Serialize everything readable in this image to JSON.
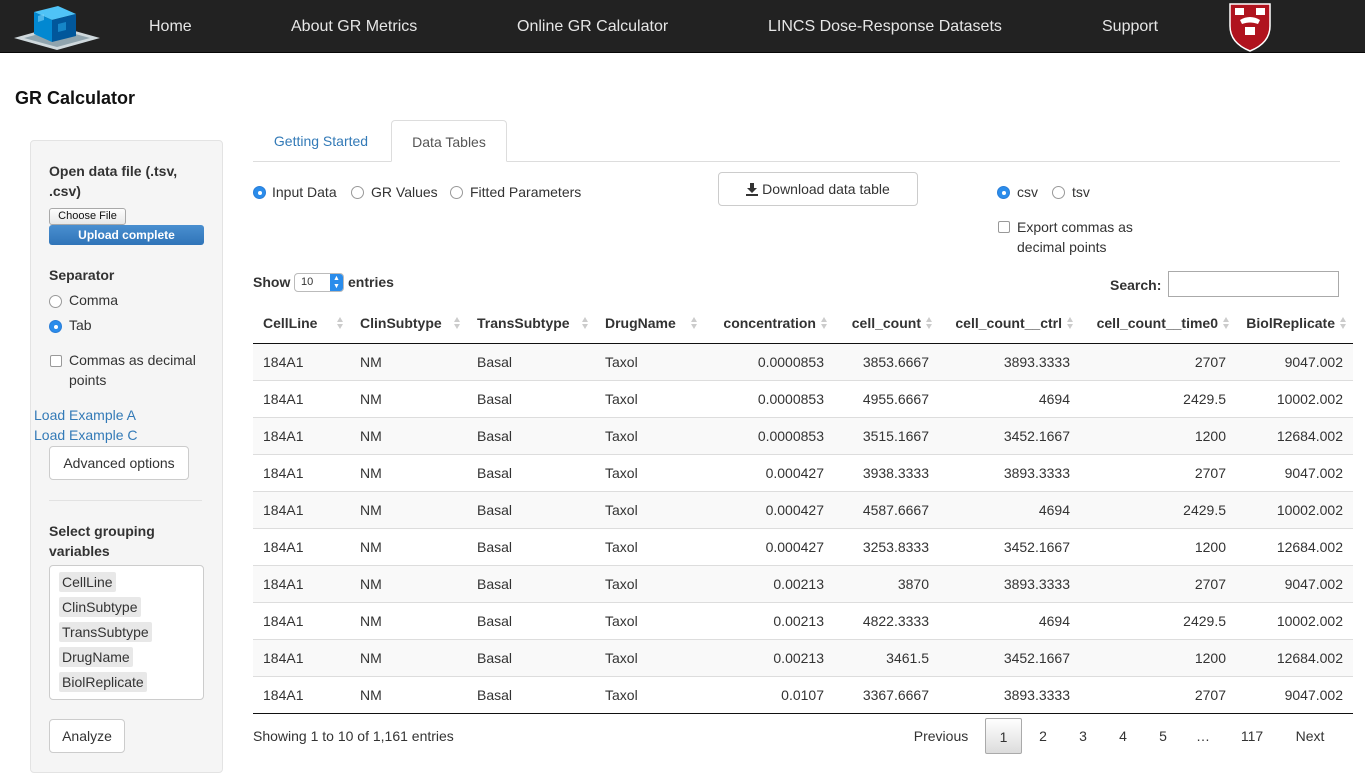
{
  "navbar": {
    "items": [
      "Home",
      "About GR Metrics",
      "Online GR Calculator",
      "LINCS Dose-Response Datasets",
      "Support"
    ]
  },
  "page_title": "GR Calculator",
  "sidebar": {
    "open_file_label": "Open data file (.tsv, .csv)",
    "choose_file": "Choose File",
    "upload_status": "Upload complete",
    "upload_progress": 1.0,
    "separator_label": "Separator",
    "separator_options": [
      "Comma",
      "Tab"
    ],
    "separator_selected": "Tab",
    "commas_decimal": "Commas as decimal points",
    "commas_decimal_checked": false,
    "load_example_a": "Load Example A",
    "load_example_c": "Load Example C",
    "advanced_options": "Advanced options",
    "grouping_label": "Select grouping variables",
    "grouping_variables": [
      "CellLine",
      "ClinSubtype",
      "TransSubtype",
      "DrugName",
      "BiolReplicate"
    ],
    "analyze": "Analyze"
  },
  "tabs": {
    "items": [
      "Getting Started",
      "Data Tables"
    ],
    "active": "Data Tables"
  },
  "data_view": {
    "options": [
      "Input Data",
      "GR Values",
      "Fitted Parameters"
    ],
    "selected": "Input Data",
    "download_label": "Download data table",
    "format_options": [
      "csv",
      "tsv"
    ],
    "format_selected": "csv",
    "export_commas": "Export commas as decimal points",
    "export_commas_checked": false
  },
  "table": {
    "show": "Show",
    "entries": "entries",
    "page_length": "10",
    "search_label": "Search:",
    "search_value": "",
    "columns": [
      "CellLine",
      "ClinSubtype",
      "TransSubtype",
      "DrugName",
      "concentration",
      "cell_count",
      "cell_count__ctrl",
      "cell_count__time0",
      "BiolReplicate"
    ],
    "rows": [
      [
        "184A1",
        "NM",
        "Basal",
        "Taxol",
        "0.0000853",
        "3853.6667",
        "3893.3333",
        "2707",
        "9047.002"
      ],
      [
        "184A1",
        "NM",
        "Basal",
        "Taxol",
        "0.0000853",
        "4955.6667",
        "4694",
        "2429.5",
        "10002.002"
      ],
      [
        "184A1",
        "NM",
        "Basal",
        "Taxol",
        "0.0000853",
        "3515.1667",
        "3452.1667",
        "1200",
        "12684.002"
      ],
      [
        "184A1",
        "NM",
        "Basal",
        "Taxol",
        "0.000427",
        "3938.3333",
        "3893.3333",
        "2707",
        "9047.002"
      ],
      [
        "184A1",
        "NM",
        "Basal",
        "Taxol",
        "0.000427",
        "4587.6667",
        "4694",
        "2429.5",
        "10002.002"
      ],
      [
        "184A1",
        "NM",
        "Basal",
        "Taxol",
        "0.000427",
        "3253.8333",
        "3452.1667",
        "1200",
        "12684.002"
      ],
      [
        "184A1",
        "NM",
        "Basal",
        "Taxol",
        "0.00213",
        "3870",
        "3893.3333",
        "2707",
        "9047.002"
      ],
      [
        "184A1",
        "NM",
        "Basal",
        "Taxol",
        "0.00213",
        "4822.3333",
        "4694",
        "2429.5",
        "10002.002"
      ],
      [
        "184A1",
        "NM",
        "Basal",
        "Taxol",
        "0.00213",
        "3461.5",
        "3452.1667",
        "1200",
        "12684.002"
      ],
      [
        "184A1",
        "NM",
        "Basal",
        "Taxol",
        "0.0107",
        "3367.6667",
        "3893.3333",
        "2707",
        "9047.002"
      ]
    ],
    "info": "Showing 1 to 10 of 1,161 entries"
  },
  "pagination": {
    "previous": "Previous",
    "pages": [
      "1",
      "2",
      "3",
      "4",
      "5",
      "…",
      "117"
    ],
    "current": "1",
    "next": "Next"
  }
}
